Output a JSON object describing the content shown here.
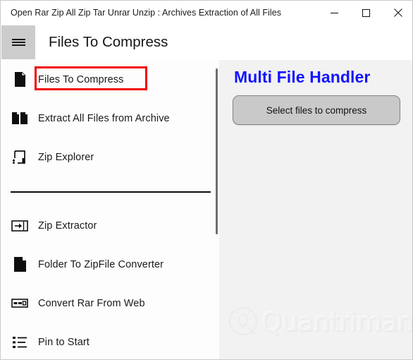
{
  "window": {
    "title": "Open Rar Zip All Zip Tar Unrar Unzip : Archives Extraction of All Files",
    "controls": {
      "minimize": "minimize-button",
      "maximize": "maximize-button",
      "close": "close-button"
    }
  },
  "header": {
    "menu_button": "hamburger-menu",
    "page_title": "Files To Compress"
  },
  "sidebar": {
    "items": [
      {
        "label": "Files To Compress",
        "icon": "document-icon",
        "selected": true
      },
      {
        "label": "Extract All Files from  Archive",
        "icon": "copy-documents-icon",
        "selected": false
      },
      {
        "label": "Zip Explorer",
        "icon": "upload-box-icon",
        "selected": false
      },
      {
        "label": "Zip Extractor",
        "icon": "import-arrow-icon",
        "selected": false
      },
      {
        "label": "Folder To ZipFile Converter",
        "icon": "folder-icon",
        "selected": false
      },
      {
        "label": "Convert Rar From Web",
        "icon": "web-bar-icon",
        "selected": false
      },
      {
        "label": "Pin to Start",
        "icon": "list-icon",
        "selected": false
      }
    ],
    "divider_after_index": 2,
    "highlight_color": "#f10000"
  },
  "content": {
    "title": "Multi File Handler",
    "title_color": "#1414ff",
    "select_button_label": "Select files to compress",
    "background_color": "#f2f2f2",
    "watermark": "Quantrimang"
  }
}
